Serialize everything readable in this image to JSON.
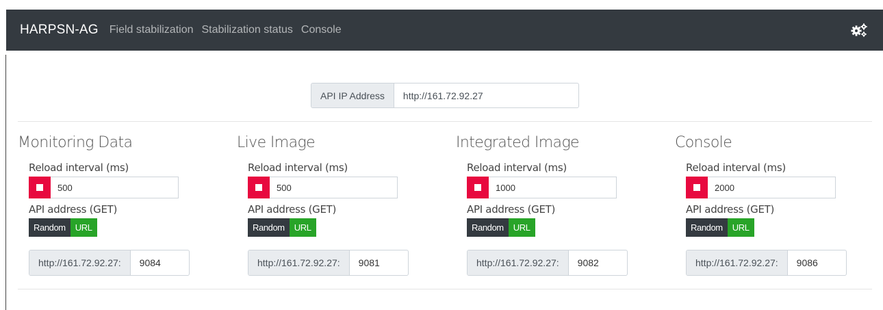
{
  "navbar": {
    "brand": "HARPSN-AG",
    "links": [
      "Field stabilization",
      "Stabilization status",
      "Console"
    ]
  },
  "api_ip": {
    "label": "API IP Address",
    "value": "http://161.72.92.27"
  },
  "panels": [
    {
      "title": "Monitoring Data",
      "interval_label": "Reload interval (ms)",
      "interval": "500",
      "address_label": "API address (GET)",
      "toggle_random": "Random",
      "toggle_url": "URL",
      "url_prefix": "http://161.72.92.27:",
      "port": "9084"
    },
    {
      "title": "Live Image",
      "interval_label": "Reload interval (ms)",
      "interval": "500",
      "address_label": "API address (GET)",
      "toggle_random": "Random",
      "toggle_url": "URL",
      "url_prefix": "http://161.72.92.27:",
      "port": "9081"
    },
    {
      "title": "Integrated Image",
      "interval_label": "Reload interval (ms)",
      "interval": "1000",
      "address_label": "API address (GET)",
      "toggle_random": "Random",
      "toggle_url": "URL",
      "url_prefix": "http://161.72.92.27:",
      "port": "9082"
    },
    {
      "title": "Console",
      "interval_label": "Reload interval (ms)",
      "interval": "2000",
      "address_label": "API address (GET)",
      "toggle_random": "Random",
      "toggle_url": "URL",
      "url_prefix": "http://161.72.92.27:",
      "port": "9086"
    }
  ],
  "colors": {
    "navbar": "#343a40",
    "stop": "#e8093f",
    "url_active": "#28a428"
  },
  "icons": {
    "settings": "gears-icon"
  }
}
